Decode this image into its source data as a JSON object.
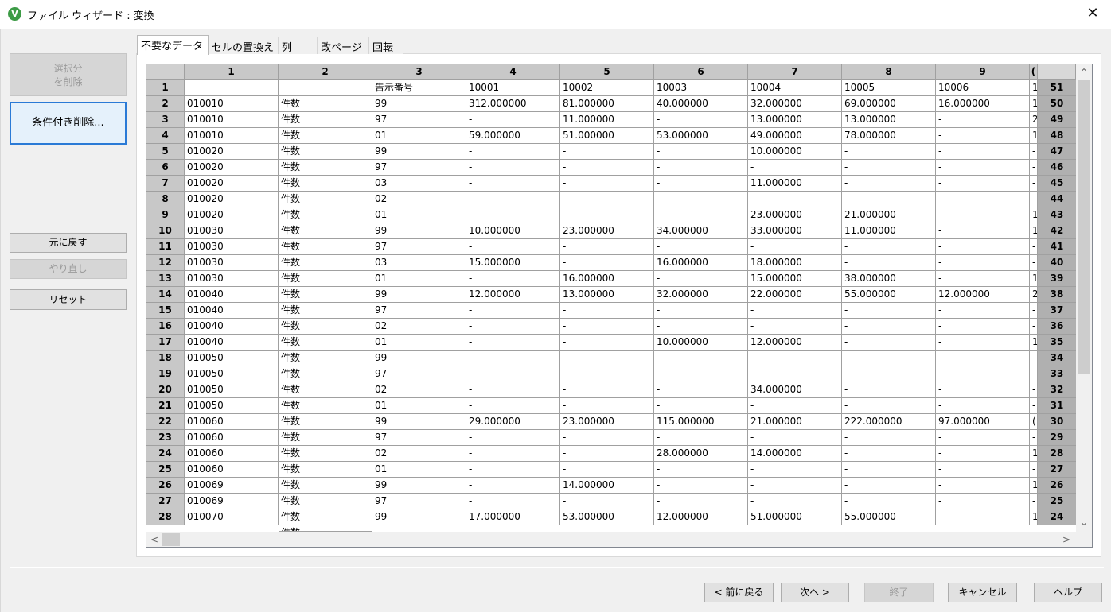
{
  "window": {
    "title": "ファイル ウィザード : 変換",
    "icon_letter": "V",
    "close_glyph": "✕"
  },
  "sidebar": {
    "delete_selection_line1": "選択分",
    "delete_selection_line2": "を削除",
    "conditional_delete": "条件付き削除...",
    "undo": "元に戻す",
    "redo": "やり直し",
    "reset": "リセット"
  },
  "tabs": [
    "不要なデータ",
    "セルの置換え",
    "列",
    "改ページ",
    "回転"
  ],
  "grid": {
    "column_headers": [
      "1",
      "2",
      "3",
      "4",
      "5",
      "6",
      "7",
      "8",
      "9",
      "("
    ],
    "rows": [
      {
        "n": "1",
        "r": "51",
        "c": [
          "",
          "",
          "告示番号",
          "10001",
          "10002",
          "10003",
          "10004",
          "10005",
          "10006",
          "1"
        ]
      },
      {
        "n": "2",
        "r": "50",
        "c": [
          "010010",
          "件数",
          "99",
          "312.000000",
          "81.000000",
          "40.000000",
          "32.000000",
          "69.000000",
          "16.000000",
          "1"
        ]
      },
      {
        "n": "3",
        "r": "49",
        "c": [
          "010010",
          "件数",
          "97",
          "-",
          "11.000000",
          "-",
          "13.000000",
          "13.000000",
          "-",
          "2"
        ]
      },
      {
        "n": "4",
        "r": "48",
        "c": [
          "010010",
          "件数",
          "01",
          "59.000000",
          "51.000000",
          "53.000000",
          "49.000000",
          "78.000000",
          "-",
          "1"
        ]
      },
      {
        "n": "5",
        "r": "47",
        "c": [
          "010020",
          "件数",
          "99",
          "-",
          "-",
          "-",
          "10.000000",
          "-",
          "-",
          "-"
        ]
      },
      {
        "n": "6",
        "r": "46",
        "c": [
          "010020",
          "件数",
          "97",
          "-",
          "-",
          "-",
          "-",
          "-",
          "-",
          "-"
        ]
      },
      {
        "n": "7",
        "r": "45",
        "c": [
          "010020",
          "件数",
          "03",
          "-",
          "-",
          "-",
          "11.000000",
          "-",
          "-",
          "-"
        ]
      },
      {
        "n": "8",
        "r": "44",
        "c": [
          "010020",
          "件数",
          "02",
          "-",
          "-",
          "-",
          "-",
          "-",
          "-",
          "-"
        ]
      },
      {
        "n": "9",
        "r": "43",
        "c": [
          "010020",
          "件数",
          "01",
          "-",
          "-",
          "-",
          "23.000000",
          "21.000000",
          "-",
          "1"
        ]
      },
      {
        "n": "10",
        "r": "42",
        "c": [
          "010030",
          "件数",
          "99",
          "10.000000",
          "23.000000",
          "34.000000",
          "33.000000",
          "11.000000",
          "-",
          "1"
        ]
      },
      {
        "n": "11",
        "r": "41",
        "c": [
          "010030",
          "件数",
          "97",
          "-",
          "-",
          "-",
          "-",
          "-",
          "-",
          "-"
        ]
      },
      {
        "n": "12",
        "r": "40",
        "c": [
          "010030",
          "件数",
          "03",
          "15.000000",
          "-",
          "16.000000",
          "18.000000",
          "-",
          "-",
          "-"
        ]
      },
      {
        "n": "13",
        "r": "39",
        "c": [
          "010030",
          "件数",
          "01",
          "-",
          "16.000000",
          "-",
          "15.000000",
          "38.000000",
          "-",
          "1"
        ]
      },
      {
        "n": "14",
        "r": "38",
        "c": [
          "010040",
          "件数",
          "99",
          "12.000000",
          "13.000000",
          "32.000000",
          "22.000000",
          "55.000000",
          "12.000000",
          "2"
        ]
      },
      {
        "n": "15",
        "r": "37",
        "c": [
          "010040",
          "件数",
          "97",
          "-",
          "-",
          "-",
          "-",
          "-",
          "-",
          "-"
        ]
      },
      {
        "n": "16",
        "r": "36",
        "c": [
          "010040",
          "件数",
          "02",
          "-",
          "-",
          "-",
          "-",
          "-",
          "-",
          "-"
        ]
      },
      {
        "n": "17",
        "r": "35",
        "c": [
          "010040",
          "件数",
          "01",
          "-",
          "-",
          "10.000000",
          "12.000000",
          "-",
          "-",
          "1"
        ]
      },
      {
        "n": "18",
        "r": "34",
        "c": [
          "010050",
          "件数",
          "99",
          "-",
          "-",
          "-",
          "-",
          "-",
          "-",
          "-"
        ]
      },
      {
        "n": "19",
        "r": "33",
        "c": [
          "010050",
          "件数",
          "97",
          "-",
          "-",
          "-",
          "-",
          "-",
          "-",
          "-"
        ]
      },
      {
        "n": "20",
        "r": "32",
        "c": [
          "010050",
          "件数",
          "02",
          "-",
          "-",
          "-",
          "34.000000",
          "-",
          "-",
          "-"
        ]
      },
      {
        "n": "21",
        "r": "31",
        "c": [
          "010050",
          "件数",
          "01",
          "-",
          "-",
          "-",
          "-",
          "-",
          "-",
          "-"
        ]
      },
      {
        "n": "22",
        "r": "30",
        "c": [
          "010060",
          "件数",
          "99",
          "29.000000",
          "23.000000",
          "115.000000",
          "21.000000",
          "222.000000",
          "97.000000",
          "("
        ]
      },
      {
        "n": "23",
        "r": "29",
        "c": [
          "010060",
          "件数",
          "97",
          "-",
          "-",
          "-",
          "-",
          "-",
          "-",
          "-"
        ]
      },
      {
        "n": "24",
        "r": "28",
        "c": [
          "010060",
          "件数",
          "02",
          "-",
          "-",
          "28.000000",
          "14.000000",
          "-",
          "-",
          "1"
        ]
      },
      {
        "n": "25",
        "r": "27",
        "c": [
          "010060",
          "件数",
          "01",
          "-",
          "-",
          "-",
          "-",
          "-",
          "-",
          "-"
        ]
      },
      {
        "n": "26",
        "r": "26",
        "c": [
          "010069",
          "件数",
          "99",
          "-",
          "14.000000",
          "-",
          "-",
          "-",
          "-",
          "1"
        ]
      },
      {
        "n": "27",
        "r": "25",
        "c": [
          "010069",
          "件数",
          "97",
          "-",
          "-",
          "-",
          "-",
          "-",
          "-",
          "-"
        ]
      },
      {
        "n": "28",
        "r": "24",
        "c": [
          "010070",
          "件数",
          "99",
          "17.000000",
          "53.000000",
          "12.000000",
          "51.000000",
          "55.000000",
          "-",
          "1"
        ]
      }
    ],
    "partial_row_text": "件数"
  },
  "scroll": {
    "up": "⌃",
    "down": "⌄",
    "left": "<",
    "right": ">"
  },
  "footer": {
    "back": "< 前に戻る",
    "next": "次へ >",
    "finish": "終了",
    "cancel": "キャンセル",
    "help": "ヘルプ"
  }
}
